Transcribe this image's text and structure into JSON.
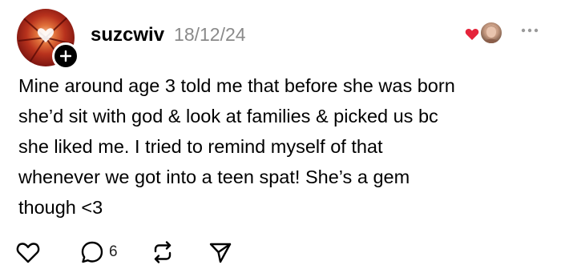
{
  "post": {
    "author": {
      "username": "suzcwiv",
      "avatar_icon": "red-autumn-tree-avatar",
      "follow_icon": "plus-icon"
    },
    "timestamp": "18/12/24",
    "liked_by": {
      "heart_icon": "heart-icon",
      "heart_color": "#e5243b",
      "avatar_icon": "liker-avatar"
    },
    "more_icon": "more-horizontal-icon",
    "text": "Mine around age 3 told me that before she was born\nshe’d sit with god & look at families & picked us bc\nshe liked me. I tried to remind myself of that\nwhenever we got into a teen spat! She’s a gem\nthough <3",
    "actions": {
      "like_icon": "heart-outline-icon",
      "reply_icon": "speech-bubble-icon",
      "reply_count": "6",
      "repost_icon": "repost-icon",
      "share_icon": "send-icon"
    }
  }
}
